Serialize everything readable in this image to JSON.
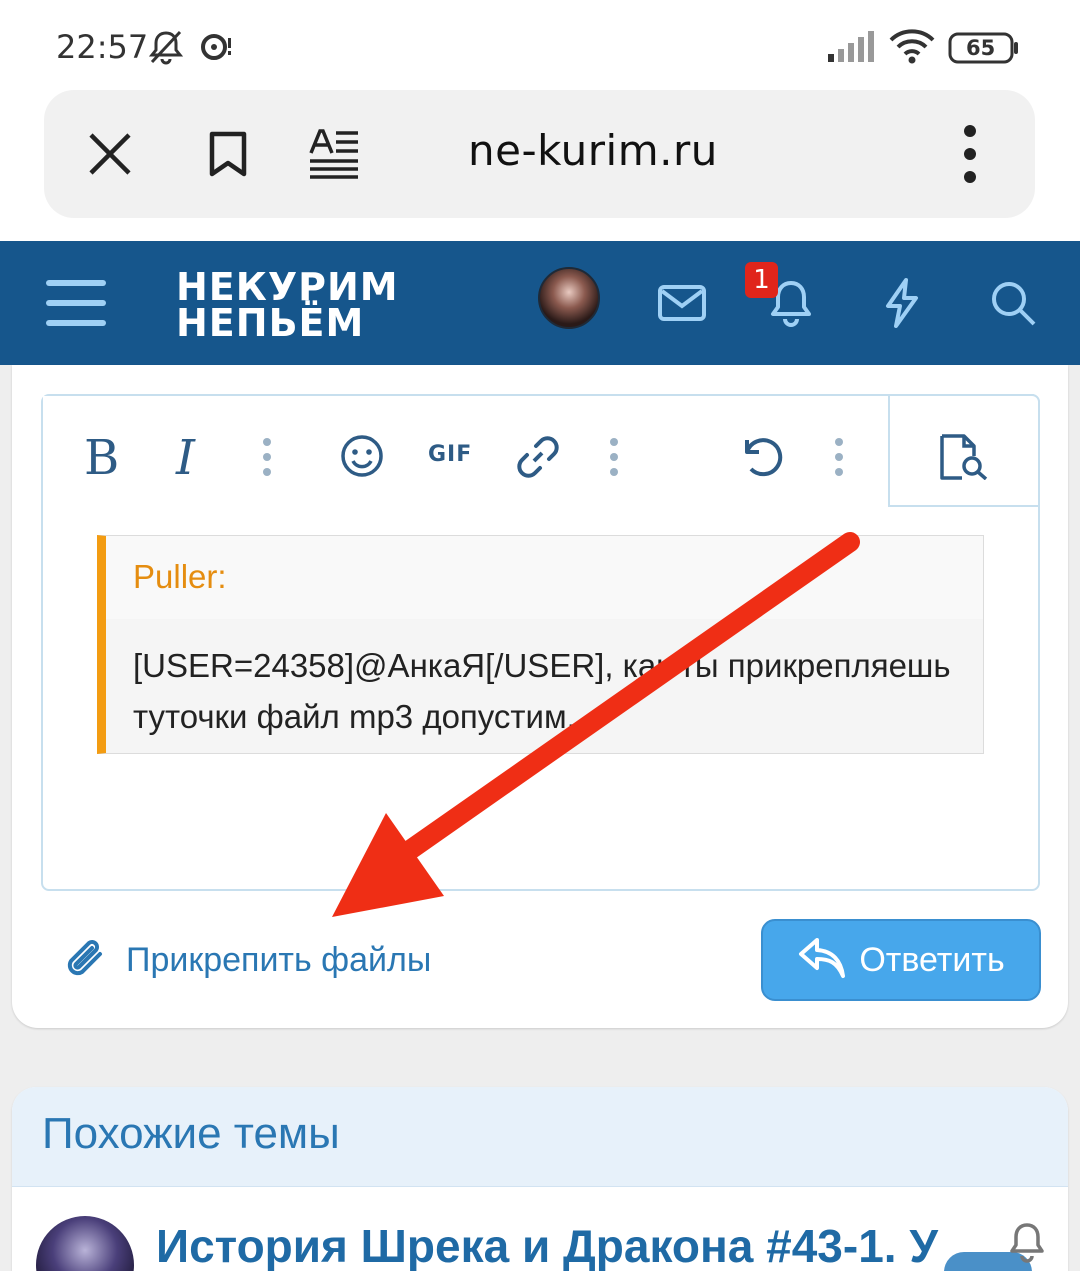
{
  "status_bar": {
    "time": "22:57",
    "battery": "65",
    "icons": [
      "mute-icon",
      "media-icon",
      "signal-icon",
      "wifi-icon",
      "battery-icon"
    ]
  },
  "browser": {
    "url": "ne-kurim.ru",
    "icons": [
      "close-icon",
      "bookmark-icon",
      "reader-mode-icon",
      "more-icon"
    ]
  },
  "header": {
    "logo_line1": "НЕКУРИМ",
    "logo_line2": "НЕПЬЁМ",
    "notification_count": "1",
    "icons": [
      "menu-icon",
      "avatar",
      "mail-icon",
      "bell-icon",
      "lightning-icon",
      "search-icon"
    ],
    "colors": {
      "background": "#16568c"
    }
  },
  "editor": {
    "toolbar_icons": [
      "bold-icon",
      "italic-icon",
      "more-icon",
      "smile-icon",
      "gif-icon",
      "link-icon",
      "more-icon",
      "undo-icon",
      "more-icon",
      "preview-icon"
    ],
    "bold_label": "B",
    "italic_label": "I",
    "gif_label": "GIF",
    "quote": {
      "author": "Puller:",
      "text": "[USER=24358]@АнкаЯ[/USER], как ты прикрепляешь туточки файл mp3 допустим.",
      "accent_color": "#f39c12"
    }
  },
  "actions": {
    "attach_label": "Прикрепить файлы",
    "reply_label": "Ответить",
    "reply_color": "#47a7eb"
  },
  "similar": {
    "title": "Похожие темы",
    "threads": [
      {
        "title": "История Шрека и Дракона #43-1. У"
      }
    ]
  }
}
